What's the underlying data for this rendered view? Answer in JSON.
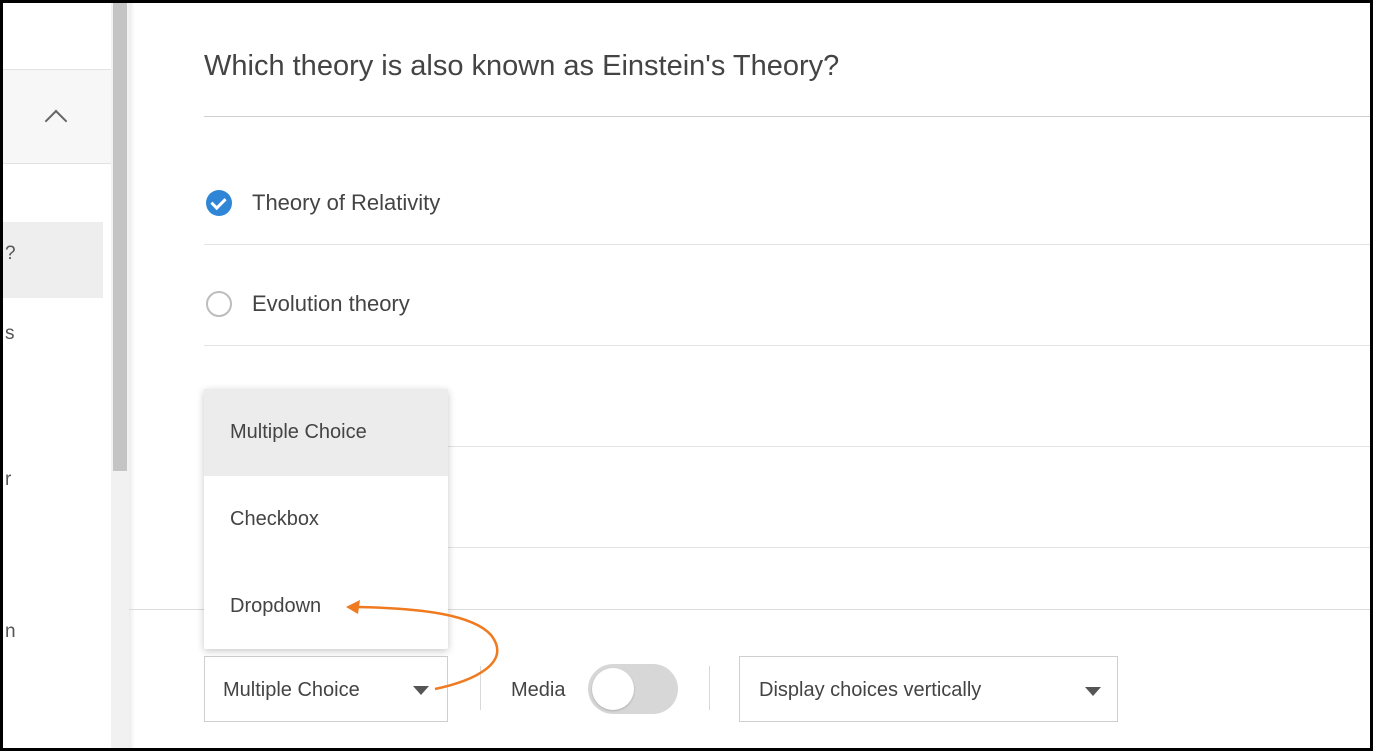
{
  "sidebar": {
    "fragments": [
      "?",
      "s",
      "r",
      "n"
    ]
  },
  "question": {
    "title": "Which theory is also known as Einstein's Theory?",
    "choices": [
      {
        "label": "Theory of Relativity",
        "checked": true
      },
      {
        "label": "Evolution theory",
        "checked": false
      }
    ]
  },
  "type_menu": {
    "options": [
      "Multiple Choice",
      "Checkbox",
      "Dropdown"
    ],
    "highlighted": "Multiple Choice"
  },
  "toolbar": {
    "question_type": "Multiple Choice",
    "media_label": "Media",
    "media_enabled": false,
    "display_option": "Display choices vertically"
  },
  "colors": {
    "accent": "#2f86d6",
    "annotation": "#f07a1f"
  },
  "icons": {
    "collapse": "chevron-up-icon",
    "check": "check-circle-icon",
    "dropdown": "caret-down-icon"
  }
}
